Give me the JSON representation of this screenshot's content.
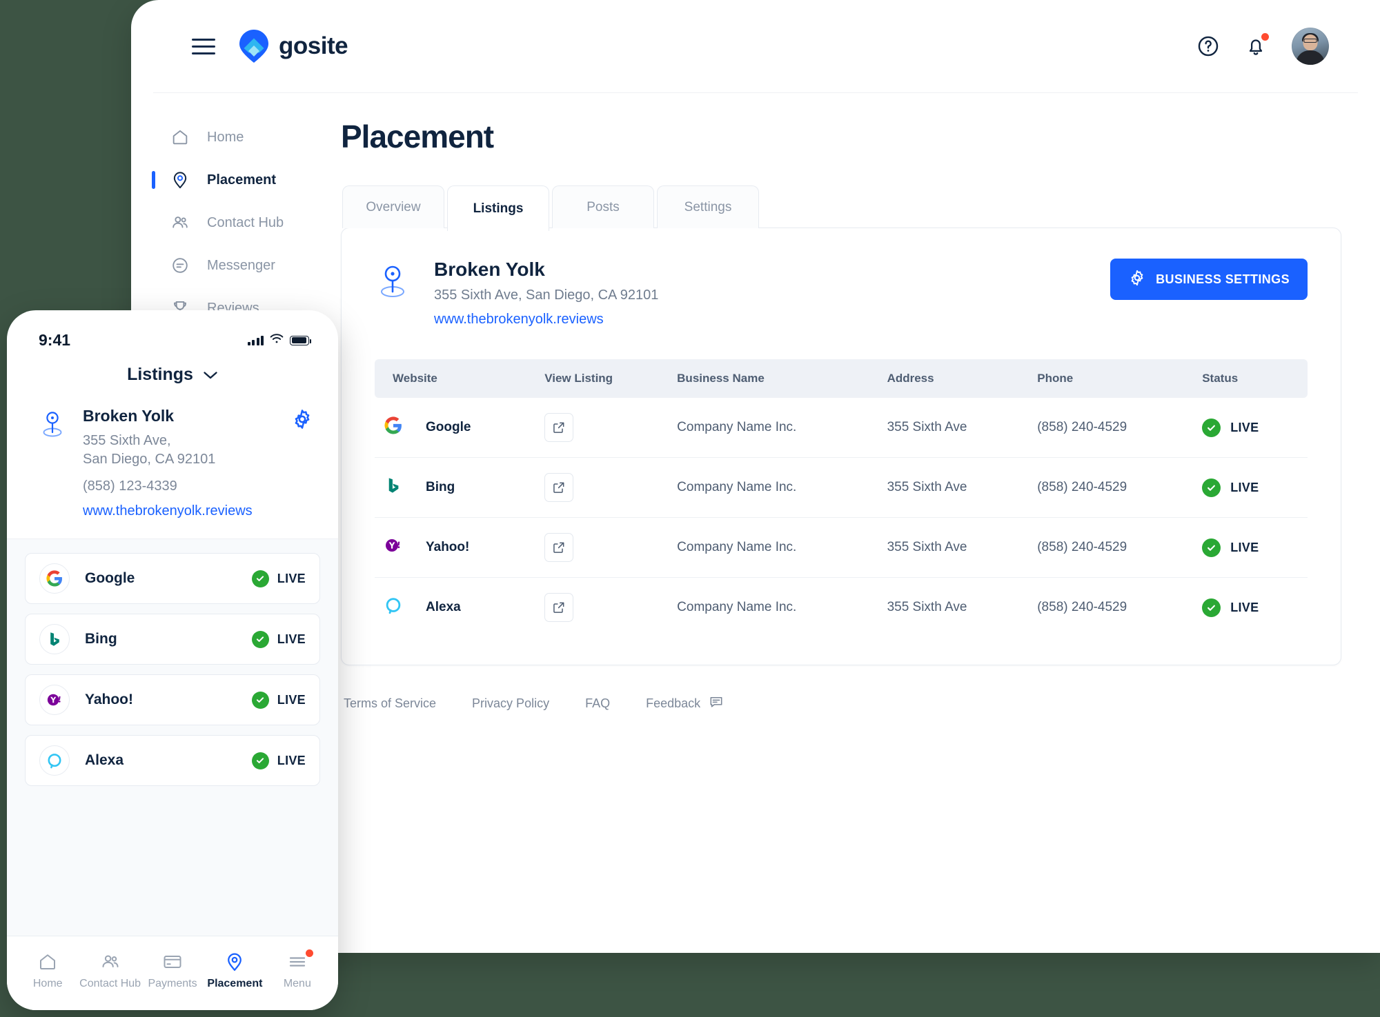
{
  "brand": {
    "name": "gosite"
  },
  "header": {
    "menu_icon": "hamburger-icon",
    "help_icon": "help-circle-icon",
    "notifications_icon": "bell-icon",
    "avatar_alt": "user-avatar"
  },
  "sidebar": {
    "items": [
      {
        "label": "Home",
        "icon": "home-icon",
        "active": false
      },
      {
        "label": "Placement",
        "icon": "map-pin-icon",
        "active": true
      },
      {
        "label": "Contact Hub",
        "icon": "people-icon",
        "active": false
      },
      {
        "label": "Messenger",
        "icon": "message-icon",
        "active": false
      },
      {
        "label": "Reviews",
        "icon": "trophy-icon",
        "active": false
      }
    ]
  },
  "main": {
    "page_title": "Placement",
    "tabs": [
      {
        "label": "Overview",
        "active": false
      },
      {
        "label": "Listings",
        "active": true
      },
      {
        "label": "Posts",
        "active": false
      },
      {
        "label": "Settings",
        "active": false
      }
    ],
    "business": {
      "name": "Broken Yolk",
      "address": "355 Sixth Ave, San Diego, CA 92101",
      "website": "www.thebrokenyolk.reviews",
      "settings_button": "BUSINESS SETTINGS",
      "settings_icon": "gear-icon",
      "pin_icon": "location-pin-icon"
    },
    "table": {
      "columns": [
        "Website",
        "View Listing",
        "Business Name",
        "Address",
        "Phone",
        "Status"
      ],
      "rows": [
        {
          "website": "Google",
          "icon": "google-icon",
          "view": "external-link-icon",
          "business_name": "Company Name Inc.",
          "address": "355 Sixth Ave",
          "phone": "(858) 240-4529",
          "status": "LIVE"
        },
        {
          "website": "Bing",
          "icon": "bing-icon",
          "view": "external-link-icon",
          "business_name": "Company Name Inc.",
          "address": "355 Sixth Ave",
          "phone": "(858) 240-4529",
          "status": "LIVE"
        },
        {
          "website": "Yahoo!",
          "icon": "yahoo-icon",
          "view": "external-link-icon",
          "business_name": "Company Name Inc.",
          "address": "355 Sixth Ave",
          "phone": "(858) 240-4529",
          "status": "LIVE"
        },
        {
          "website": "Alexa",
          "icon": "alexa-icon",
          "view": "external-link-icon",
          "business_name": "Company Name Inc.",
          "address": "355 Sixth Ave",
          "phone": "(858) 240-4529",
          "status": "LIVE"
        }
      ]
    },
    "footer": {
      "terms": "Terms of Service",
      "privacy": "Privacy Policy",
      "faq": "FAQ",
      "feedback": "Feedback",
      "feedback_icon": "comment-icon"
    }
  },
  "phone": {
    "status_bar": {
      "time": "9:41",
      "signal_icon": "cellular-bars-icon",
      "wifi_icon": "wifi-icon",
      "battery_icon": "battery-icon"
    },
    "title": "Listings",
    "title_chevron": "chevron-down-icon",
    "business": {
      "name": "Broken Yolk",
      "address_line1": "355 Sixth Ave,",
      "address_line2": "San Diego, CA 92101",
      "phone": "(858) 123-4339",
      "website": "www.thebrokenyolk.reviews",
      "pin_icon": "location-pin-icon",
      "settings_icon": "gear-icon"
    },
    "listings": [
      {
        "name": "Google",
        "icon": "google-icon",
        "status": "LIVE"
      },
      {
        "name": "Bing",
        "icon": "bing-icon",
        "status": "LIVE"
      },
      {
        "name": "Yahoo!",
        "icon": "yahoo-icon",
        "status": "LIVE"
      },
      {
        "name": "Alexa",
        "icon": "alexa-icon",
        "status": "LIVE"
      }
    ],
    "nav": [
      {
        "label": "Home",
        "icon": "home-icon",
        "active": false,
        "badge": false
      },
      {
        "label": "Contact Hub",
        "icon": "people-icon",
        "active": false,
        "badge": false
      },
      {
        "label": "Payments",
        "icon": "credit-card-icon",
        "active": false,
        "badge": false
      },
      {
        "label": "Placement",
        "icon": "map-pin-icon",
        "active": true,
        "badge": false
      },
      {
        "label": "Menu",
        "icon": "hamburger-icon",
        "active": false,
        "badge": true
      }
    ]
  },
  "colors": {
    "accent": "#1a61ff",
    "navy": "#10243f",
    "success": "#2aa834",
    "alert": "#ff4b30",
    "muted": "#8a95a5"
  }
}
